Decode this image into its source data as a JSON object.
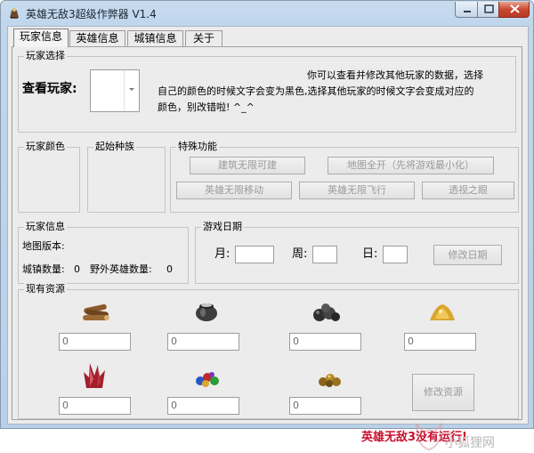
{
  "window": {
    "title": "英雄无敌3超级作弊器 V1.4"
  },
  "tabs": [
    {
      "label": "玩家信息"
    },
    {
      "label": "英雄信息"
    },
    {
      "label": "城镇信息"
    },
    {
      "label": "关于"
    }
  ],
  "player_select": {
    "group_title": "玩家选择",
    "view_label": "查看玩家:",
    "selected": "",
    "help_text_1": "你可以查看并修改其他玩家的数据，选择",
    "help_text_2": "自己的颜色的时候文字会变为黑色,选择其他玩家的时候文字会变成对应的",
    "help_text_3": "颜色，别改错啦! ^_^"
  },
  "player_color": {
    "group_title": "玩家颜色"
  },
  "start_race": {
    "group_title": "起始种族"
  },
  "special": {
    "group_title": "特殊功能",
    "buttons": {
      "build_unlimited": "建筑无限可建",
      "map_open": "地图全开（先将游戏最小化）",
      "hero_move": "英雄无限移动",
      "hero_fly": "英雄无限飞行",
      "see_through": "透视之眼"
    }
  },
  "player_info": {
    "group_title": "玩家信息",
    "map_version_label": "地图版本:",
    "town_count_label": "城镇数量:",
    "town_count": "0",
    "wild_heroes_label": "野外英雄数量:",
    "wild_heroes": "0"
  },
  "game_date": {
    "group_title": "游戏日期",
    "month_label": "月:",
    "week_label": "周:",
    "day_label": "日:",
    "month": "",
    "week": "",
    "day": "",
    "modify_button": "修改日期"
  },
  "resources": {
    "group_title": "现有资源",
    "items": [
      {
        "icon": "wood-icon",
        "value": "0"
      },
      {
        "icon": "mercury-icon",
        "value": "0"
      },
      {
        "icon": "ore-icon",
        "value": "0"
      },
      {
        "icon": "sulfur-icon",
        "value": "0"
      },
      {
        "icon": "crystal-icon",
        "value": "0"
      },
      {
        "icon": "gems-icon",
        "value": "0"
      },
      {
        "icon": "gold-icon",
        "value": "0"
      }
    ],
    "modify_button": "修改资源"
  },
  "status": {
    "text": "英雄无敌3没有运行!"
  },
  "watermark": {
    "text": "小狐狸网"
  }
}
